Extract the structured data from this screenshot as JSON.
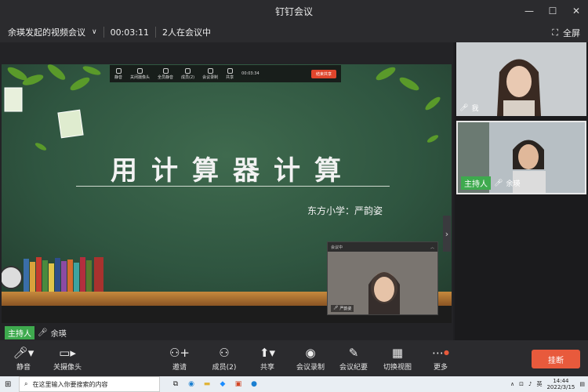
{
  "window": {
    "title": "钉钉会议",
    "min_icon": "minimize-icon",
    "max_icon": "maximize-icon",
    "close_icon": "close-icon"
  },
  "meeting": {
    "name": "余瑛发起的视频会议",
    "timer": "00:03:11",
    "participants": "2人在会议中",
    "fullscreen_label": "全屏"
  },
  "slide": {
    "title": "用计算器计算",
    "author": "东方小学：严韵姿",
    "float_toolbar": {
      "items": [
        "静音",
        "关闭摄像头",
        "全员静音",
        "成员(2)",
        "会议录制",
        "共享"
      ],
      "timer": "00:03:34",
      "end_share": "结束共享"
    },
    "mini_video": {
      "header": "会议中",
      "name": "严韵姿"
    }
  },
  "host_tag": {
    "badge": "主持人",
    "name": "余瑛"
  },
  "right_tiles": [
    {
      "name": "我",
      "badge": ""
    },
    {
      "name": "余瑛",
      "badge": "主持人"
    }
  ],
  "controls": {
    "mute": "静音",
    "camera": "关摄像头",
    "invite": "邀请",
    "members": "成员(2)",
    "share": "共享",
    "record": "会议录制",
    "minutes": "会议纪要",
    "switch_view": "切换视图",
    "more": "更多",
    "hangup": "挂断"
  },
  "taskbar": {
    "search_placeholder": "在这里输入你要搜索的内容",
    "time": "14:44",
    "date": "2022/3/15",
    "lang": "英"
  }
}
